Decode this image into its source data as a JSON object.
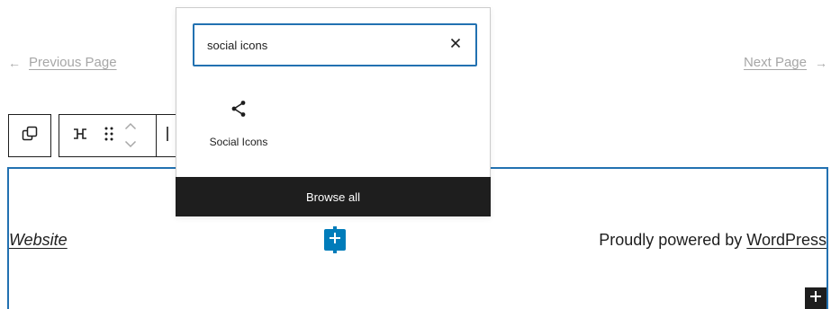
{
  "pagination": {
    "prev_arrow": "←",
    "prev_label": "Previous Page",
    "next_label": "Next Page",
    "next_arrow": "→"
  },
  "toolbar": {
    "parent_icon": "select-parent-icon",
    "transform_icon": "group-row-icon",
    "drag_icon": "drag-handle-icon",
    "move_up_icon": "chevron-up-icon",
    "move_down_icon": "chevron-down-icon",
    "align_icon": "justify-left-icon"
  },
  "inserter": {
    "search": {
      "value": "social icons",
      "placeholder": "Search"
    },
    "clear_icon": "close-icon",
    "results": [
      {
        "label": "Social Icons",
        "icon": "share-icon"
      }
    ],
    "browse_all_label": "Browse all"
  },
  "footer": {
    "site_link": "Website",
    "powered_prefix": "Proudly powered by ",
    "powered_link": "WordPress",
    "inserter_icon": "plus-icon"
  },
  "colors": {
    "accent": "#2271b1",
    "inserter_blue": "#007cba",
    "dark": "#1e1e1e",
    "muted_link": "#a7a7a7"
  }
}
